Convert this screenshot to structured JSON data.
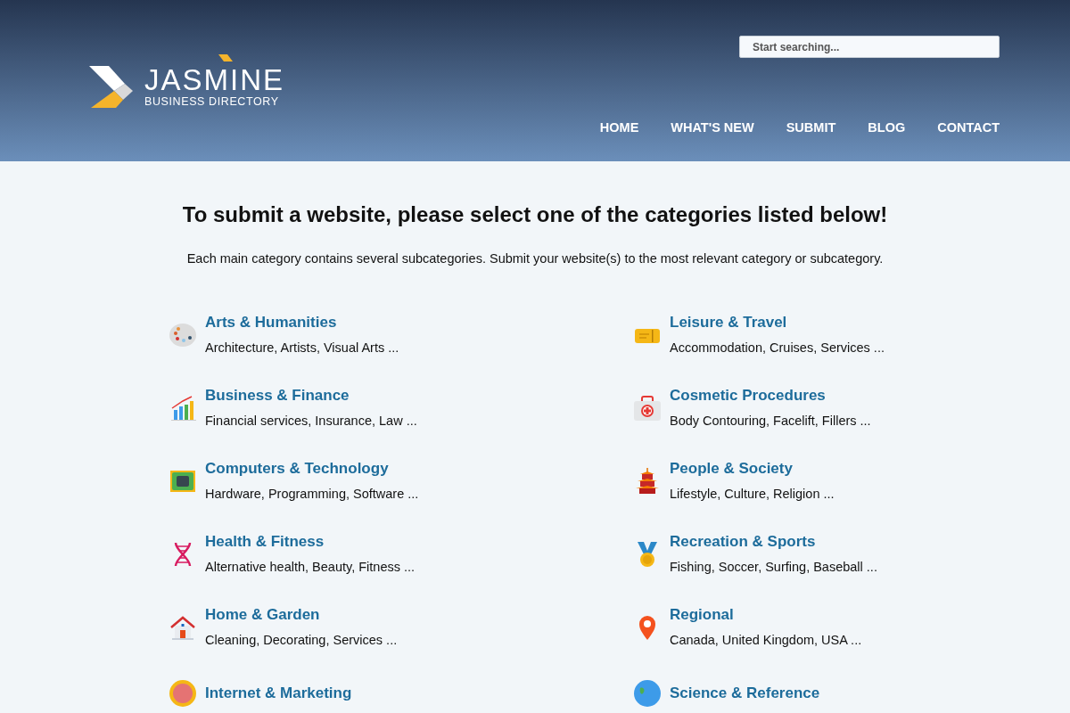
{
  "header": {
    "logo": {
      "name": "JASMINE",
      "tagline": "BUSINESS DIRECTORY"
    },
    "search": {
      "placeholder": "Start searching..."
    },
    "nav": [
      {
        "label": "HOME"
      },
      {
        "label": "WHAT'S NEW"
      },
      {
        "label": "SUBMIT"
      },
      {
        "label": "BLOG"
      },
      {
        "label": "CONTACT"
      }
    ]
  },
  "main": {
    "heading": "To submit a website, please select one of the categories listed below!",
    "intro": "Each main category contains several subcategories. Submit your website(s) to the most relevant category or subcategory.",
    "categories": [
      {
        "kind": "palette",
        "title": "Arts & Humanities",
        "subcategories": "Architecture, Artists, Visual Arts ..."
      },
      {
        "kind": "ticket",
        "title": "Leisure & Travel",
        "subcategories": "Accommodation, Cruises, Services ..."
      },
      {
        "kind": "chart",
        "title": "Business & Finance",
        "subcategories": "Financial services, Insurance, Law ..."
      },
      {
        "kind": "firstaid",
        "title": "Cosmetic Procedures",
        "subcategories": "Body Contouring, Facelift, Fillers ..."
      },
      {
        "kind": "chip",
        "title": "Computers & Technology",
        "subcategories": "Hardware, Programming, Software ..."
      },
      {
        "kind": "pagoda",
        "title": "People & Society",
        "subcategories": "Lifestyle, Culture, Religion ..."
      },
      {
        "kind": "dna",
        "title": "Health & Fitness",
        "subcategories": "Alternative health, Beauty, Fitness ..."
      },
      {
        "kind": "medal",
        "title": "Recreation & Sports",
        "subcategories": "Fishing, Soccer, Surfing, Baseball ..."
      },
      {
        "kind": "house",
        "title": "Home & Garden",
        "subcategories": "Cleaning, Decorating, Services ..."
      },
      {
        "kind": "pin",
        "title": "Regional",
        "subcategories": "Canada, United Kingdom, USA ..."
      },
      {
        "kind": "target",
        "title": "Internet & Marketing"
      },
      {
        "kind": "globe",
        "title": "Science & Reference"
      }
    ]
  }
}
